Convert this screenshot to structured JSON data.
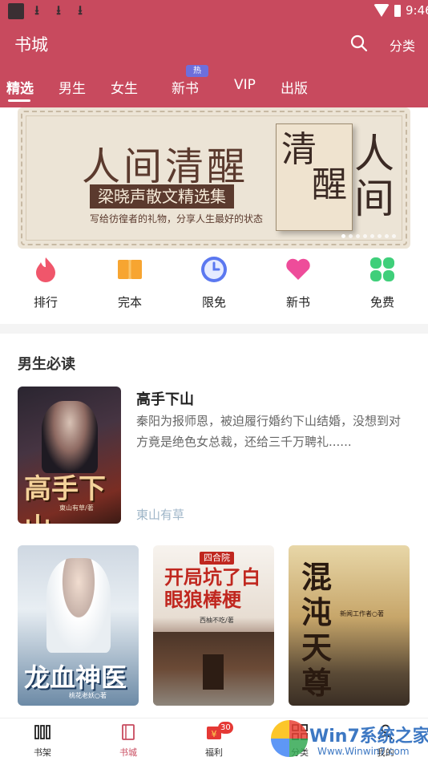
{
  "status_bar": {
    "time": "9:46"
  },
  "header": {
    "title": "书城",
    "category_label": "分类"
  },
  "tabs": [
    {
      "label": "精选",
      "active": true
    },
    {
      "label": "男生"
    },
    {
      "label": "女生"
    },
    {
      "label": "新书",
      "badge": "热"
    },
    {
      "label": "VIP"
    },
    {
      "label": "出版"
    }
  ],
  "banner": {
    "title": "人间清醒",
    "author": "梁晓声散文精选集",
    "slogan": "写给彷徨者的礼物，分享人生最好的状态",
    "book_text_1": "清",
    "book_text_2": "醒",
    "book_text_3": "人间",
    "dots_total": 8,
    "dot_active": 0
  },
  "quick_entries": [
    {
      "label": "排行",
      "icon": "flame-icon",
      "color": "#f0566b"
    },
    {
      "label": "完本",
      "icon": "book-open-icon",
      "color": "#f7a531"
    },
    {
      "label": "限免",
      "icon": "clock-icon",
      "color": "#5b78f0"
    },
    {
      "label": "新书",
      "icon": "heart-icon",
      "color": "#ee4c9a"
    },
    {
      "label": "免费",
      "icon": "clover-icon",
      "color": "#3fcf7a"
    }
  ],
  "section": {
    "title": "男生必读",
    "featured": {
      "title": "高手下山",
      "description": "秦阳为报师恩，被迫履行婚约下山结婚，没想到对方竟是绝色女总裁，还给三千万聘礼......",
      "author": "東山有草",
      "cover_text": "高手下山",
      "cover_author": "東山有草/著"
    },
    "books": [
      {
        "cover_text": "龙血神医",
        "cover_sub": "桃花老妖○著"
      },
      {
        "cover_text": "开局坑了白眼狼棒梗",
        "cover_sub": "西柚不吃/著",
        "badge": "四合院"
      },
      {
        "cover_text": "混沌天尊",
        "cover_sub": "新闻工作者○著"
      }
    ]
  },
  "tabbar": [
    {
      "label": "书架",
      "icon": "bookshelf-icon"
    },
    {
      "label": "书城",
      "icon": "bookstore-icon",
      "active": true
    },
    {
      "label": "福利",
      "icon": "gift-icon",
      "badge": "30"
    },
    {
      "label": "分类",
      "icon": "grid-icon"
    },
    {
      "label": "我的",
      "icon": "user-icon"
    }
  ],
  "watermark": {
    "text": "Win7系统之家",
    "url": "Www.Winwin7.com"
  }
}
